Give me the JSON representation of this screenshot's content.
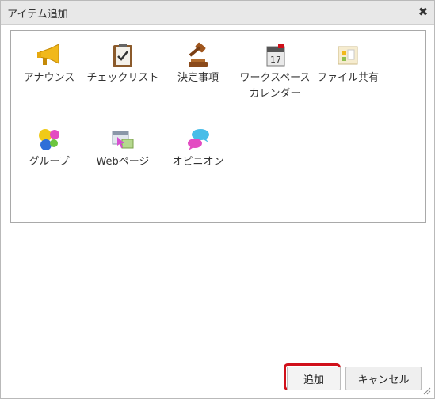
{
  "dialog": {
    "title": "アイテム追加",
    "close_icon": "close-icon"
  },
  "items": [
    {
      "label": "アナウンス",
      "icon": "megaphone-icon"
    },
    {
      "label": "チェックリスト",
      "icon": "checklist-icon"
    },
    {
      "label": "決定事項",
      "icon": "gavel-icon"
    },
    {
      "label": "ワークスペースカレンダー",
      "icon": "calendar-icon"
    },
    {
      "label": "ファイル共有",
      "icon": "folder-icon"
    },
    {
      "label": "グループ",
      "icon": "group-icon"
    },
    {
      "label": "Webページ",
      "icon": "webpage-icon"
    },
    {
      "label": "オピニオン",
      "icon": "speech-bubble-icon"
    }
  ],
  "buttons": {
    "add_label": "追加",
    "cancel_label": "キャンセル"
  },
  "colors": {
    "highlight": "#d0101a",
    "titlebar": "#e8e8e8"
  }
}
